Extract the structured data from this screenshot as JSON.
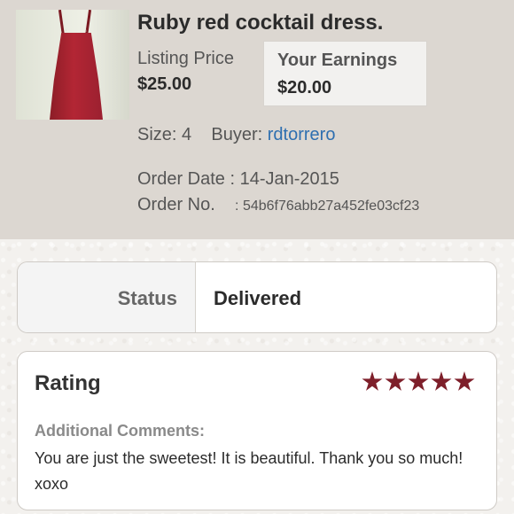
{
  "listing": {
    "title": "Ruby red cocktail dress.",
    "listing_price_label": "Listing Price",
    "listing_price_value": "$25.00",
    "earnings_label": "Your Earnings",
    "earnings_value": "$20.00"
  },
  "details": {
    "size_text": "Size: 4",
    "buyer_label": "Buyer:",
    "buyer_name": "rdtorrero",
    "order_date_text": "Order Date : 14-Jan-2015",
    "order_no_label": "Order No.",
    "order_no_value": ": 54b6f76abb27a452fe03cf23"
  },
  "status": {
    "label": "Status",
    "value": "Delivered"
  },
  "rating": {
    "title": "Rating",
    "stars": 5,
    "comments_label": "Additional Comments:",
    "comments_text": "You are just the sweetest! It is beautiful. Thank you so much! xoxo"
  },
  "colors": {
    "star": "#7e1f2a",
    "link": "#2e6fb0",
    "header_bg": "#dcd7d1"
  }
}
